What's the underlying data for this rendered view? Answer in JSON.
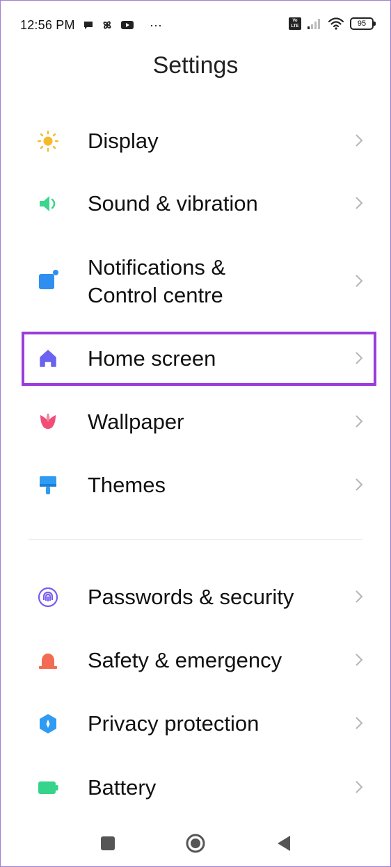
{
  "status_bar": {
    "time": "12:56 PM",
    "more": "···",
    "volte_label": "Vo\nLTE",
    "battery_level": "95"
  },
  "page": {
    "title": "Settings"
  },
  "settings_items": [
    {
      "label": "Display",
      "icon": "sun-icon",
      "color": "#f6b92b"
    },
    {
      "label": "Sound & vibration",
      "icon": "speaker-icon",
      "color": "#3cd58b"
    },
    {
      "label": "Notifications &",
      "label2": "Control centre",
      "icon": "notification-icon",
      "color": "#2f8ff0"
    },
    {
      "label": "Home screen",
      "icon": "home-icon",
      "color": "#6b63f0"
    },
    {
      "label": "Wallpaper",
      "icon": "tulip-icon",
      "color": "#f04d79"
    },
    {
      "label": "Themes",
      "icon": "brush-icon",
      "color": "#2f9bf2"
    },
    {
      "label": "Passwords & security",
      "icon": "fingerprint-icon",
      "color": "#7a5cf0"
    },
    {
      "label": "Safety & emergency",
      "icon": "alarm-icon",
      "color": "#f26b52"
    },
    {
      "label": "Privacy protection",
      "icon": "privacy-icon",
      "color": "#2f9bf2"
    },
    {
      "label": "Battery",
      "icon": "battery-icon",
      "color": "#35d48a"
    }
  ],
  "highlight_color": "#9b3bdc"
}
